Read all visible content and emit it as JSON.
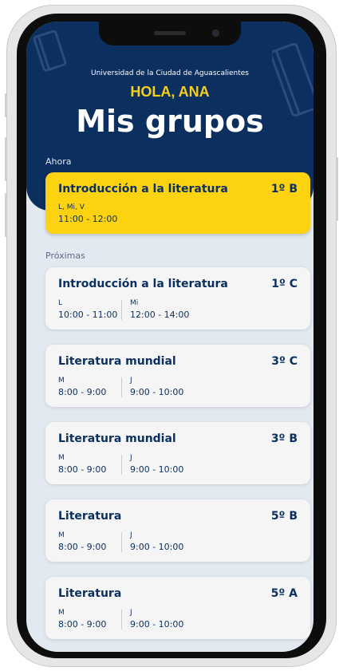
{
  "header": {
    "university": "Universidad de la Ciudad de Aguascalientes",
    "greeting": "HOLA, ANA",
    "title": "Mis grupos"
  },
  "sections": {
    "now_label": "Ahora",
    "upcoming_label": "Próximas"
  },
  "current": {
    "title": "Introducción a la literatura",
    "group": "1º B",
    "days": "L, Mi, V",
    "time": "11:00 - 12:00"
  },
  "upcoming": [
    {
      "title": "Introducción a la literatura",
      "group": "1º C",
      "slots": [
        {
          "days": "L",
          "time": "10:00 - 11:00"
        },
        {
          "days": "Mi",
          "time": "12:00 - 14:00"
        }
      ]
    },
    {
      "title": "Literatura mundial",
      "group": "3º C",
      "slots": [
        {
          "days": "M",
          "time": "8:00 - 9:00"
        },
        {
          "days": "J",
          "time": "9:00 - 10:00"
        }
      ]
    },
    {
      "title": "Literatura mundial",
      "group": "3º B",
      "slots": [
        {
          "days": "M",
          "time": "8:00 - 9:00"
        },
        {
          "days": "J",
          "time": "9:00 - 10:00"
        }
      ]
    },
    {
      "title": "Literatura",
      "group": "5º B",
      "slots": [
        {
          "days": "M",
          "time": "8:00 - 9:00"
        },
        {
          "days": "J",
          "time": "9:00 - 10:00"
        }
      ]
    },
    {
      "title": "Literatura",
      "group": "5º A",
      "slots": [
        {
          "days": "M",
          "time": "8:00 - 9:00"
        },
        {
          "days": "J",
          "time": "9:00 - 10:00"
        }
      ]
    }
  ],
  "colors": {
    "navy": "#0b2f5f",
    "yellow": "#fcd211",
    "greeting_yellow": "#f5cf1c",
    "background": "#e3e9f1"
  }
}
